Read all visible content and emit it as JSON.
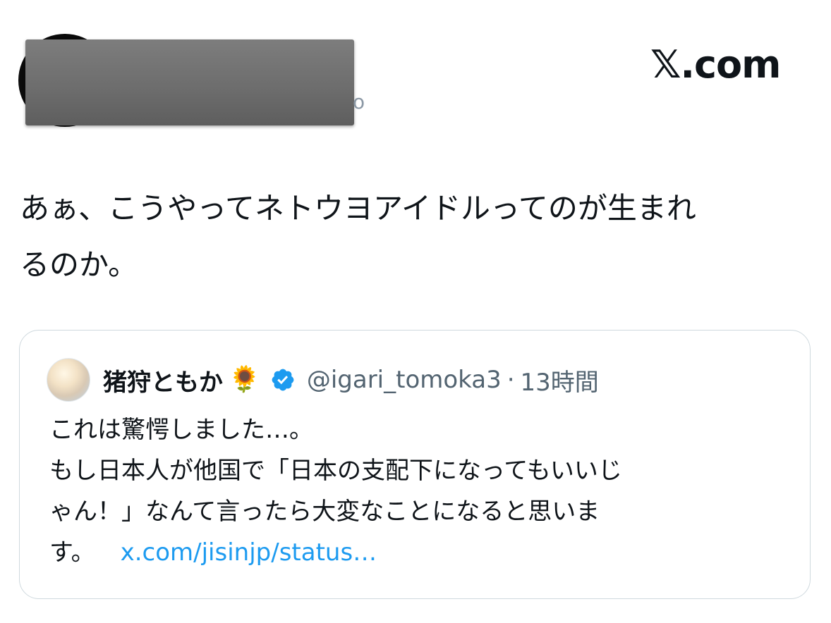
{
  "header": {
    "brand": "𝕏.com"
  },
  "post": {
    "text_line1": "あぁ、こうやってネトウヨアイドルってのが生まれ",
    "text_line2": "るのか。"
  },
  "quoted": {
    "name": "猪狩ともか",
    "emoji": "🌻",
    "handle": "@igari_tomoka3",
    "separator": "·",
    "time": "13時間",
    "line1": "これは驚愕しました…。",
    "line2": "もし日本人が他国で「日本の支配下になってもいいじ",
    "line3": "ゃん！」なんて言ったら大変なことになると思いま",
    "line4": "す。",
    "link": "x.com/jisinjp/status…"
  },
  "colors": {
    "text": "#0f1419",
    "secondary": "#536471",
    "link": "#1d9bf0",
    "verified": "#1d9bf0",
    "border": "#cfd9de"
  },
  "icons": {
    "verified": "verified-badge-icon",
    "sunflower": "sunflower-emoji"
  }
}
